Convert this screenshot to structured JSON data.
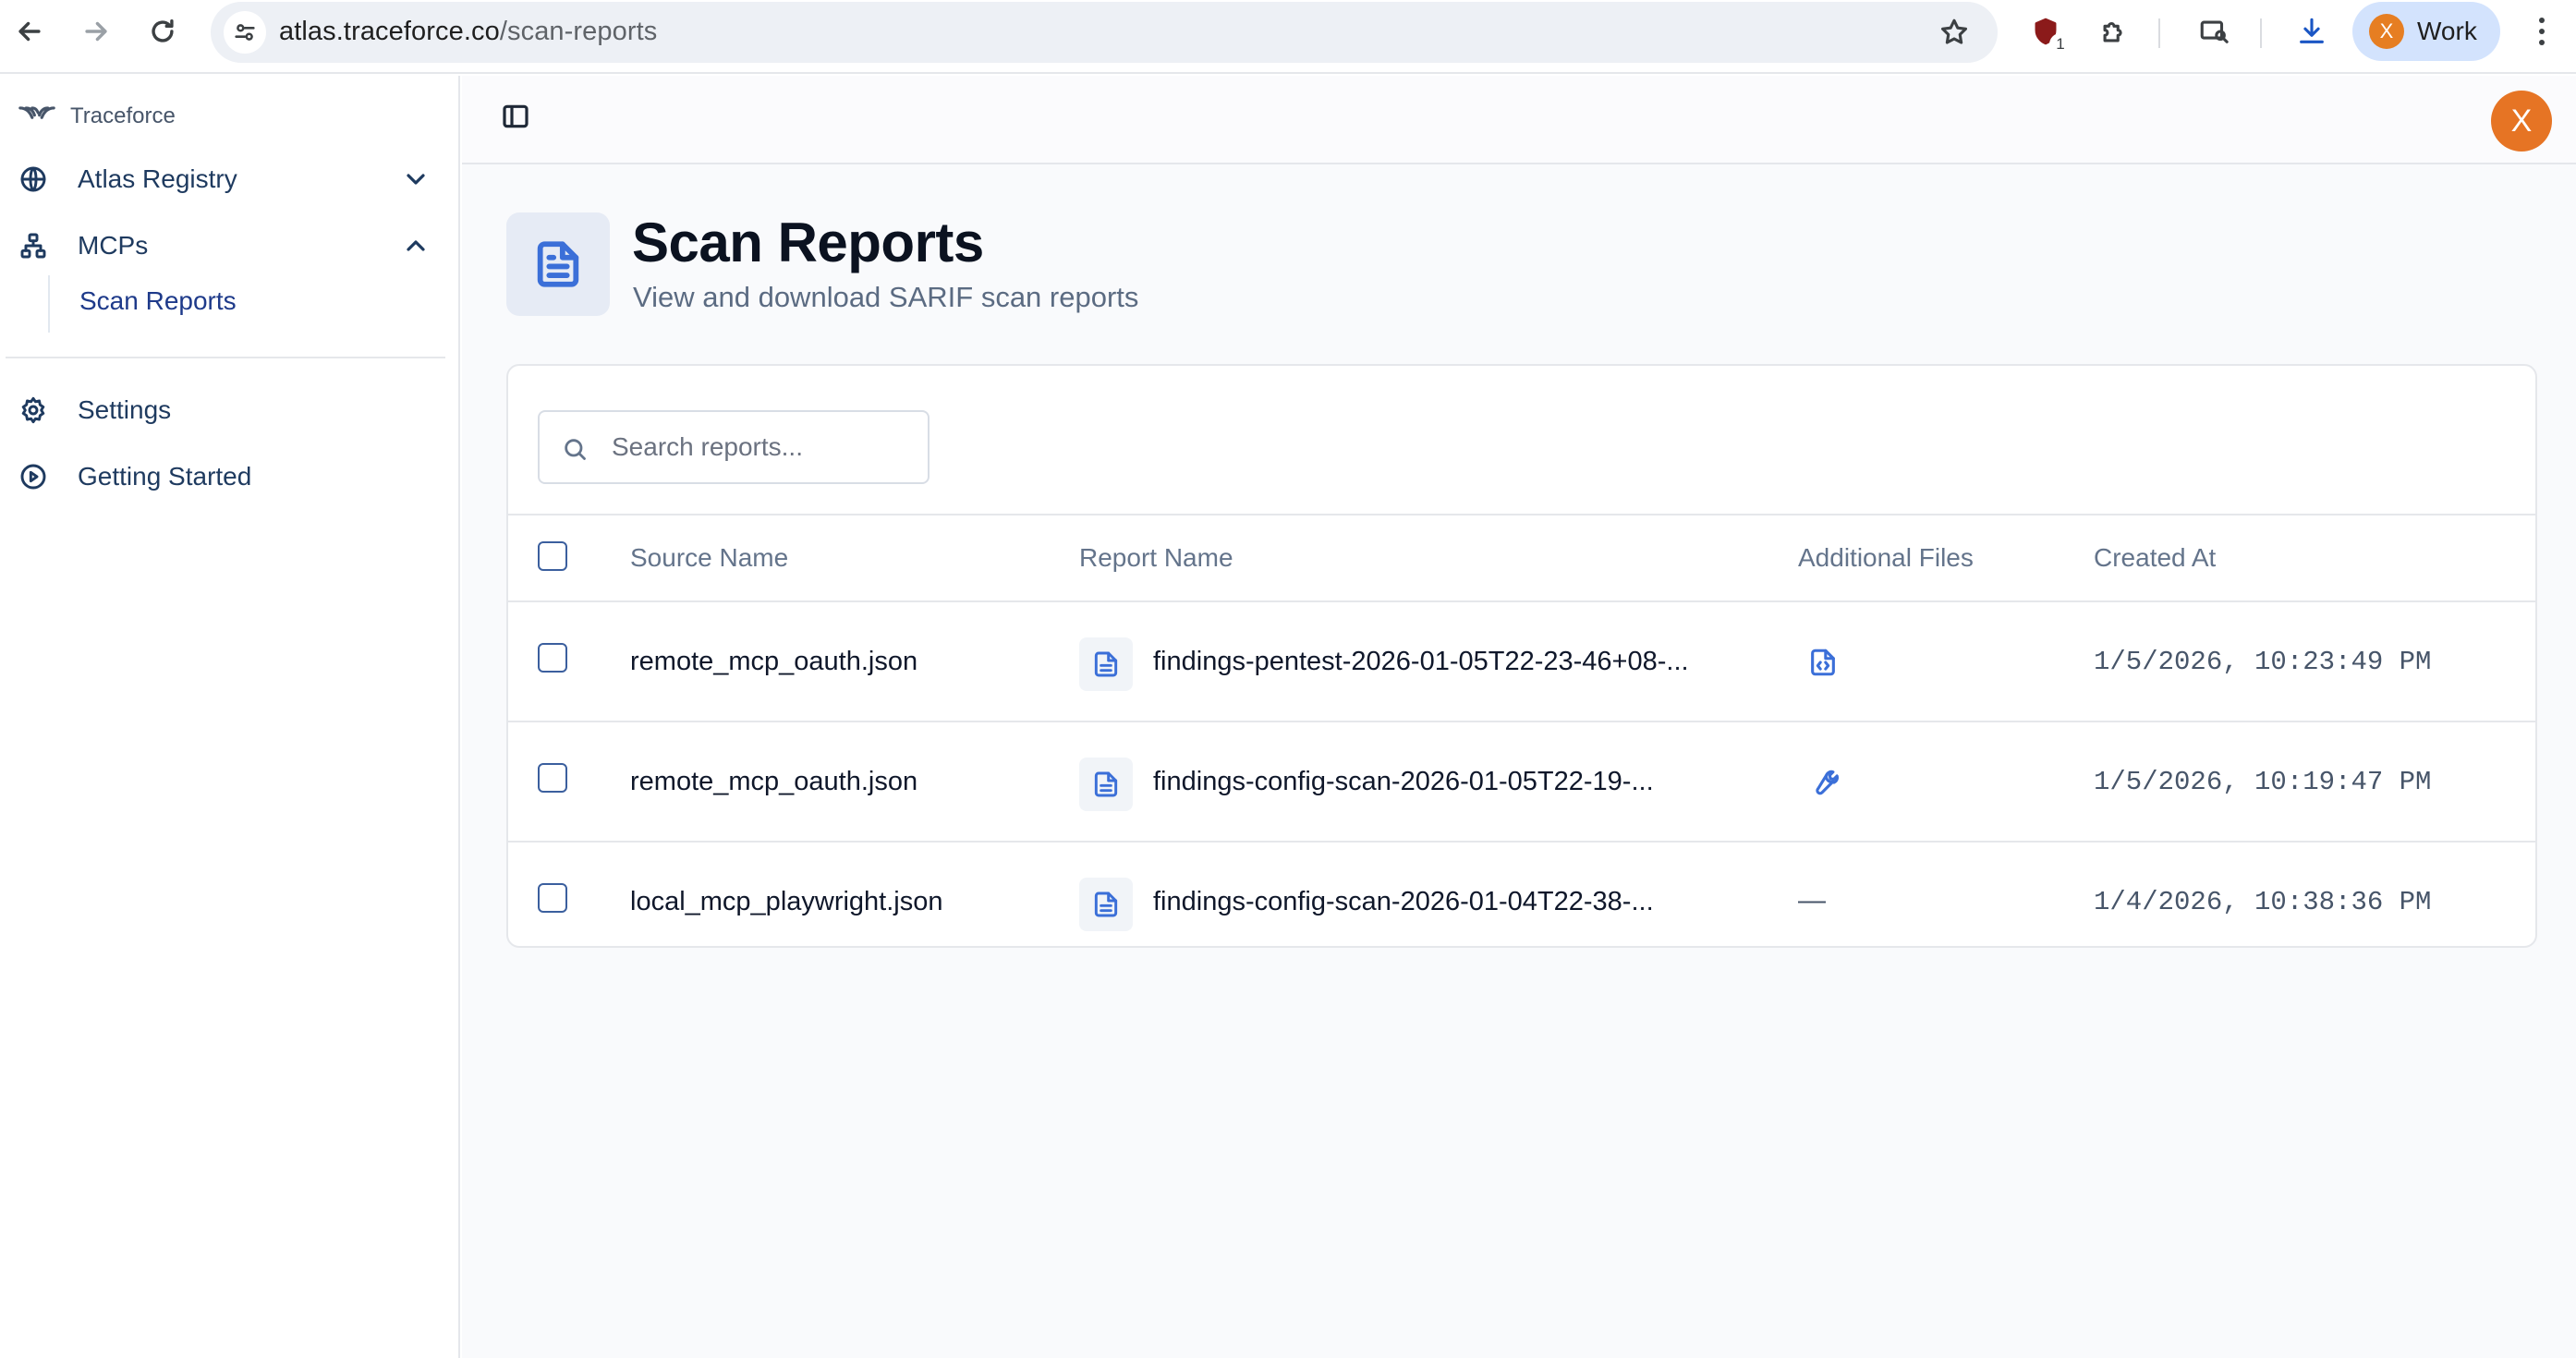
{
  "browser": {
    "url_host": "atlas.traceforce.co",
    "url_path": "/scan-reports",
    "extension_badge": "1",
    "profile_initial": "X",
    "profile_label": "Work"
  },
  "sidebar": {
    "brand": "Traceforce",
    "items": [
      {
        "label": "Atlas Registry",
        "icon": "globe-icon",
        "chevron": "chevron-down-icon"
      },
      {
        "label": "MCPs",
        "icon": "network-icon",
        "chevron": "chevron-up-icon"
      },
      {
        "label": "Settings",
        "icon": "gear-icon"
      },
      {
        "label": "Getting Started",
        "icon": "play-circle-icon"
      }
    ],
    "sub_items": [
      {
        "label": "Scan Reports"
      }
    ]
  },
  "topbar": {
    "avatar_initial": "X"
  },
  "page": {
    "title": "Scan Reports",
    "subtitle": "View and download SARIF scan reports",
    "icon": "file-text-icon"
  },
  "search": {
    "placeholder": "Search reports..."
  },
  "table": {
    "headers": {
      "source": "Source Name",
      "report": "Report Name",
      "additional": "Additional Files",
      "created": "Created At"
    },
    "rows": [
      {
        "source": "remote_mcp_oauth.json",
        "report": "findings-pentest-2026-01-05T22-23-46+08-...",
        "additional_icon": "file-code-icon",
        "additional_text": "",
        "created": "1/5/2026, 10:23:49 PM"
      },
      {
        "source": "remote_mcp_oauth.json",
        "report": "findings-config-scan-2026-01-05T22-19-...",
        "additional_icon": "wrench-icon",
        "additional_text": "",
        "created": "1/5/2026, 10:19:47 PM"
      },
      {
        "source": "local_mcp_playwright.json",
        "report": "findings-config-scan-2026-01-04T22-38-...",
        "additional_icon": "",
        "additional_text": "—",
        "created": "1/4/2026, 10:38:36 PM"
      }
    ]
  },
  "colors": {
    "accent": "#3b6fd8",
    "avatar": "#e67424",
    "nav_text": "#1e3a5f"
  }
}
